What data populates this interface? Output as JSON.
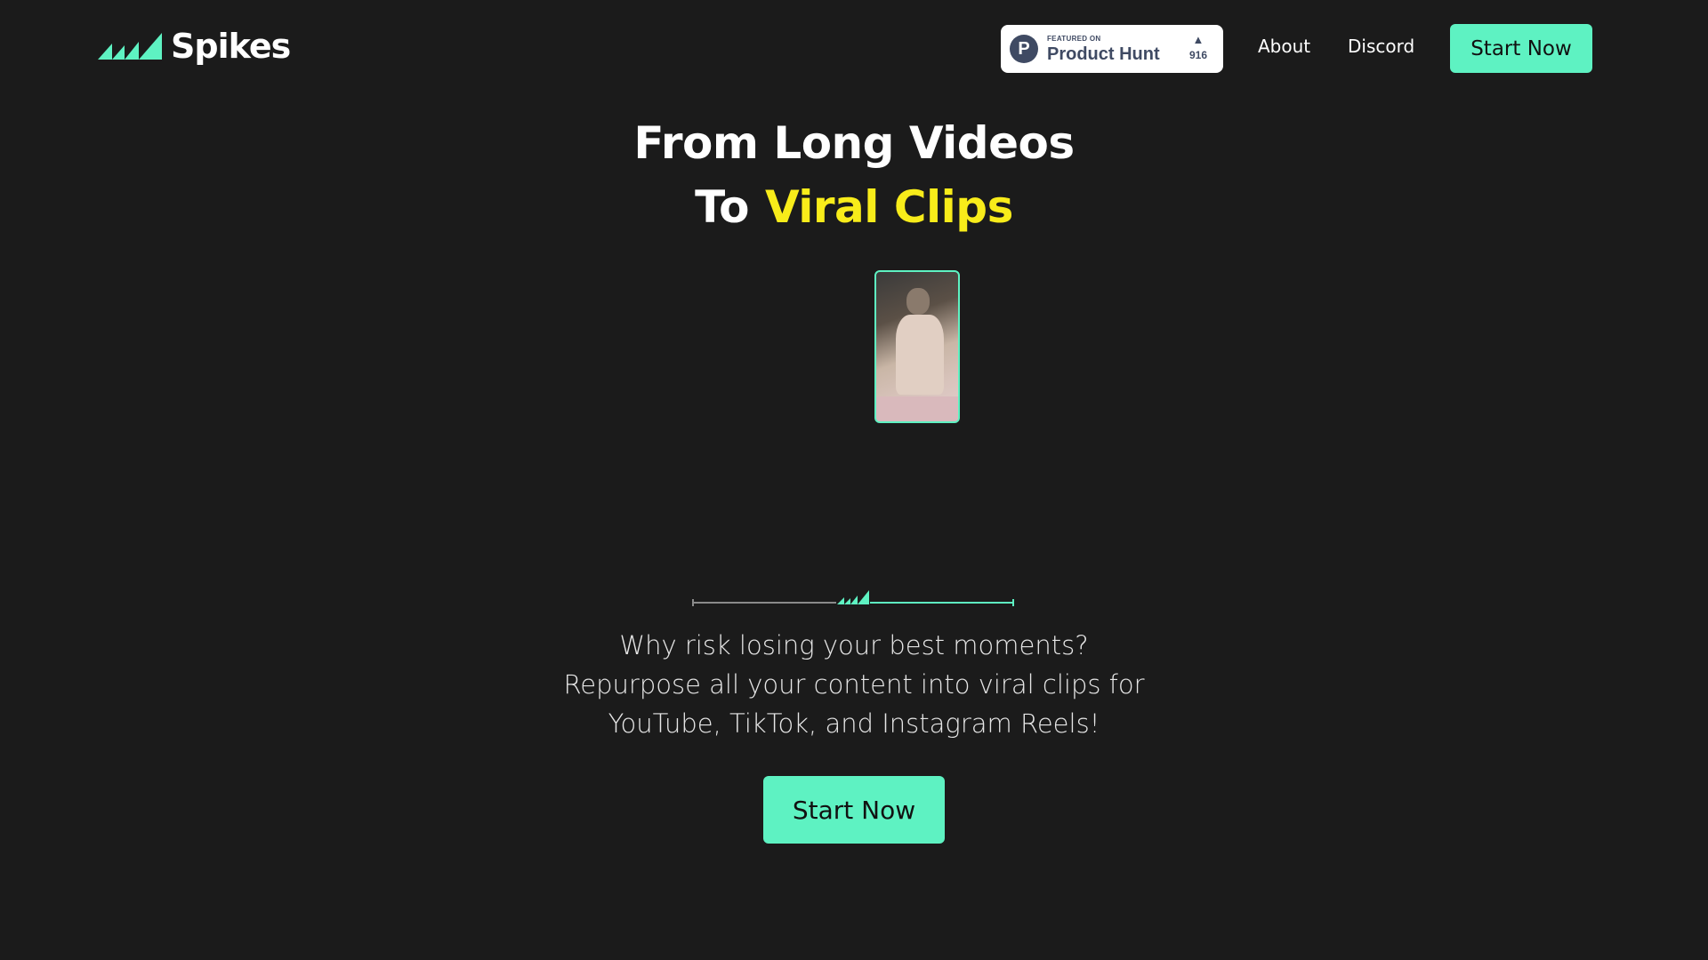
{
  "brand": {
    "name": "Spikes",
    "accent_color": "#5ef2c2",
    "highlight_color": "#f8ec1a",
    "background_color": "#1b1b1b"
  },
  "header": {
    "product_hunt": {
      "featured_label": "FEATURED ON",
      "name": "Product Hunt",
      "votes": "916"
    },
    "nav": {
      "about": "About",
      "discord": "Discord"
    },
    "cta_label": "Start Now"
  },
  "hero": {
    "title_line1": "From Long Videos",
    "title_line2_prefix": "To",
    "title_line2_accent": "Viral Clips"
  },
  "tagline": {
    "line1": "Why risk losing your best moments?",
    "line2": "Repurpose all your content into viral clips for",
    "line3": "YouTube, TikTok, and Instagram Reels!"
  },
  "hero_cta_label": "Start Now"
}
